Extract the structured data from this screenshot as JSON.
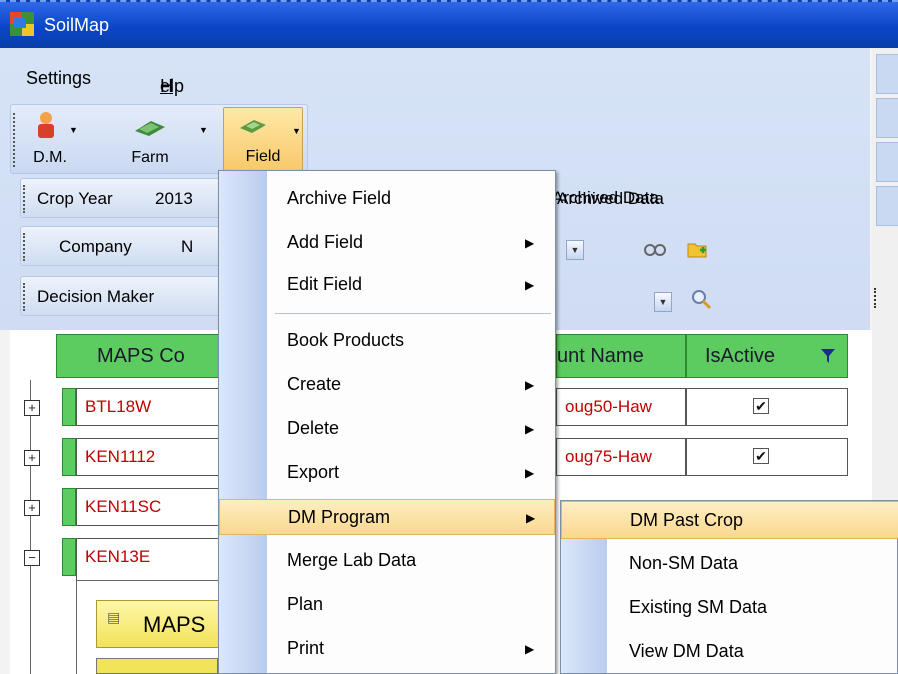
{
  "window": {
    "title": "SoilMap"
  },
  "menubar": {
    "settings": "Settings",
    "help_first": "H",
    "help_rest": "elp"
  },
  "toolbar": {
    "dm_label": "D.M.",
    "farm_label": "Farm",
    "field_label": "Field"
  },
  "filters": {
    "crop_year_label": "Crop Year",
    "crop_year_value": "2013",
    "archived_data_label": "Archived Data",
    "company_label": "Company",
    "company_value": "N",
    "decision_maker_label": "Decision Maker"
  },
  "grid": {
    "columns": [
      "MAPS Co",
      "unt Name",
      "IsActive"
    ],
    "rows": [
      {
        "code": "BTL18W",
        "account": "oug50-Haw",
        "expander": "+",
        "active": true
      },
      {
        "code": "KEN1112",
        "account": "oug75-Haw",
        "expander": "+",
        "active": true
      },
      {
        "code": "KEN11SC",
        "account": "",
        "expander": "+",
        "active": false
      },
      {
        "code": "KEN13E",
        "account": "",
        "expander": "−",
        "active": false
      }
    ],
    "subgrid_header": "MAPS"
  },
  "field_menu": {
    "items": [
      {
        "label": "Archive Field",
        "submenu": false
      },
      {
        "label": "Add Field",
        "submenu": true
      },
      {
        "label": "Edit Field",
        "submenu": true
      },
      {
        "label": "Book Products",
        "submenu": false
      },
      {
        "label": "Create",
        "submenu": true
      },
      {
        "label": "Delete",
        "submenu": true
      },
      {
        "label": "Export",
        "submenu": true
      },
      {
        "label": "DM Program",
        "submenu": true,
        "highlighted": true
      },
      {
        "label": "Merge Lab Data",
        "submenu": false
      },
      {
        "label": "Plan",
        "submenu": false
      },
      {
        "label": "Print",
        "submenu": true
      }
    ]
  },
  "dm_program_submenu": {
    "items": [
      {
        "label": "DM Past Crop",
        "highlighted": true
      },
      {
        "label": "Non-SM Data"
      },
      {
        "label": "Existing SM Data"
      },
      {
        "label": "View DM Data"
      }
    ]
  },
  "colors": {
    "titlebar": "#0b46c9",
    "grid_header_green": "#5ccb60",
    "code_text_red": "#c00000",
    "highlight": "#f9d88e",
    "subgrid_header_yellow": "#f1e35a"
  },
  "icons": {
    "app": "soilmap-app-icon",
    "dm": "person-icon",
    "farm": "farm-icon",
    "field": "field-icon",
    "dropdown": "chevron-down-icon",
    "submenu": "triangle-right-icon",
    "binoculars": "binoculars-icon",
    "folder_add": "folder-add-icon",
    "search": "magnifier-icon",
    "filter": "filter-icon",
    "checkmark": "check-icon",
    "expand": "plus-box-icon",
    "collapse": "minus-box-icon"
  }
}
